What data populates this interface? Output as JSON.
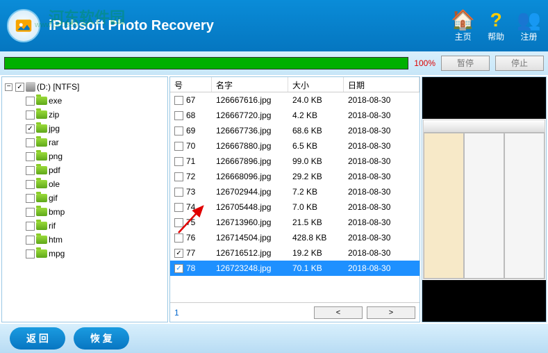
{
  "header": {
    "title": "iPubsoft Photo Recovery",
    "watermark_sub": "www.pc0359.cn",
    "watermark_main": "河东软件园",
    "buttons": {
      "home": "主页",
      "help": "帮助",
      "register": "注册"
    }
  },
  "progress": {
    "percent": "100%",
    "pause": "暂停",
    "stop": "停止"
  },
  "tree": {
    "root": "(D:) [NTFS]",
    "items": [
      {
        "label": "exe",
        "checked": false
      },
      {
        "label": "zip",
        "checked": false
      },
      {
        "label": "jpg",
        "checked": true
      },
      {
        "label": "rar",
        "checked": false
      },
      {
        "label": "png",
        "checked": false
      },
      {
        "label": "pdf",
        "checked": false
      },
      {
        "label": "ole",
        "checked": false
      },
      {
        "label": "gif",
        "checked": false
      },
      {
        "label": "bmp",
        "checked": false
      },
      {
        "label": "rif",
        "checked": false
      },
      {
        "label": "htm",
        "checked": false
      },
      {
        "label": "mpg",
        "checked": false
      }
    ]
  },
  "table": {
    "headers": {
      "num": "号",
      "name": "名字",
      "size": "大小",
      "date": "日期"
    },
    "rows": [
      {
        "n": "67",
        "name": "126667616.jpg",
        "size": "24.0 KB",
        "date": "2018-08-30",
        "c": false
      },
      {
        "n": "68",
        "name": "126667720.jpg",
        "size": "4.2 KB",
        "date": "2018-08-30",
        "c": false
      },
      {
        "n": "69",
        "name": "126667736.jpg",
        "size": "68.6 KB",
        "date": "2018-08-30",
        "c": false
      },
      {
        "n": "70",
        "name": "126667880.jpg",
        "size": "6.5 KB",
        "date": "2018-08-30",
        "c": false
      },
      {
        "n": "71",
        "name": "126667896.jpg",
        "size": "99.0 KB",
        "date": "2018-08-30",
        "c": false
      },
      {
        "n": "72",
        "name": "126668096.jpg",
        "size": "29.2 KB",
        "date": "2018-08-30",
        "c": false
      },
      {
        "n": "73",
        "name": "126702944.jpg",
        "size": "7.2 KB",
        "date": "2018-08-30",
        "c": false
      },
      {
        "n": "74",
        "name": "126705448.jpg",
        "size": "7.0 KB",
        "date": "2018-08-30",
        "c": false
      },
      {
        "n": "75",
        "name": "126713960.jpg",
        "size": "21.5 KB",
        "date": "2018-08-30",
        "c": false
      },
      {
        "n": "76",
        "name": "126714504.jpg",
        "size": "428.8 KB",
        "date": "2018-08-30",
        "c": false
      },
      {
        "n": "77",
        "name": "126716512.jpg",
        "size": "19.2 KB",
        "date": "2018-08-30",
        "c": true
      },
      {
        "n": "78",
        "name": "126723248.jpg",
        "size": "70.1 KB",
        "date": "2018-08-30",
        "c": true,
        "sel": true
      }
    ],
    "page": "1",
    "prev": "<",
    "next": ">"
  },
  "footer": {
    "back": "返 回",
    "recover": "恢 复"
  }
}
